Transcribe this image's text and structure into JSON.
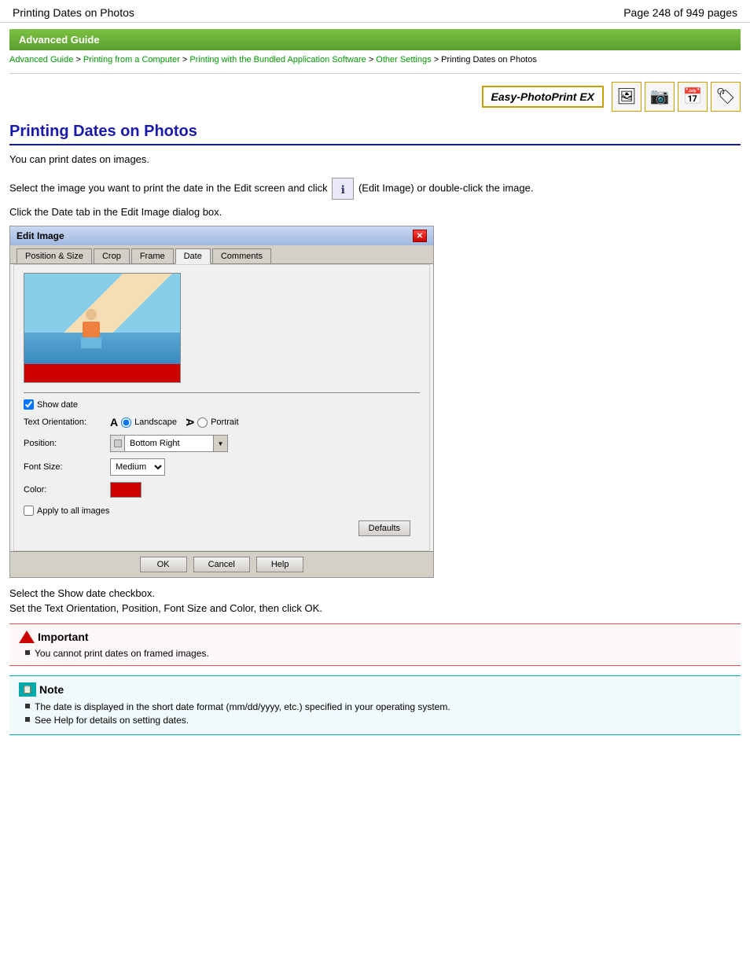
{
  "header": {
    "title": "Printing Dates on Photos",
    "pages": "Page 248 of 949 pages"
  },
  "banner": {
    "text": "Advanced Guide"
  },
  "breadcrumb": {
    "items": [
      {
        "label": "Advanced Guide",
        "link": true
      },
      {
        "label": "Printing from a Computer",
        "link": true
      },
      {
        "label": "Printing with the Bundled Application Software",
        "link": true
      },
      {
        "label": "Other Settings",
        "link": true
      },
      {
        "label": "Printing Dates on Photos",
        "link": false
      }
    ],
    "separator": " > "
  },
  "app": {
    "name": "Easy-PhotoPrint EX"
  },
  "content": {
    "page_title": "Printing Dates on Photos",
    "intro": "You can print dates on images.",
    "instruction1": "Select the image you want to print the date in the Edit screen and click",
    "instruction1b": "(Edit Image) or double-click the image.",
    "instruction2": "Click the Date tab in the Edit Image dialog box."
  },
  "dialog": {
    "title": "Edit Image",
    "tabs": [
      {
        "label": "Position & Size",
        "active": false
      },
      {
        "label": "Crop",
        "active": false
      },
      {
        "label": "Frame",
        "active": false
      },
      {
        "label": "Date",
        "active": true
      },
      {
        "label": "Comments",
        "active": false
      }
    ],
    "show_date_label": "Show date",
    "text_orientation_label": "Text Orientation:",
    "landscape_label": "Landscape",
    "portrait_label": "Portrait",
    "position_label": "Position:",
    "position_value": "Bottom Right",
    "font_size_label": "Font Size:",
    "font_size_value": "Medium",
    "color_label": "Color:",
    "apply_label": "Apply to all images",
    "defaults_btn": "Defaults",
    "ok_btn": "OK",
    "cancel_btn": "Cancel",
    "help_btn": "Help"
  },
  "post_instructions": [
    "Select the Show date checkbox.",
    "Set the Text Orientation, Position, Font Size and Color, then click OK."
  ],
  "important": {
    "header": "Important",
    "items": [
      "You cannot print dates on framed images."
    ]
  },
  "note": {
    "header": "Note",
    "items": [
      "The date is displayed in the short date format (mm/dd/yyyy, etc.) specified in your operating system.",
      "See Help for details on setting dates."
    ]
  }
}
